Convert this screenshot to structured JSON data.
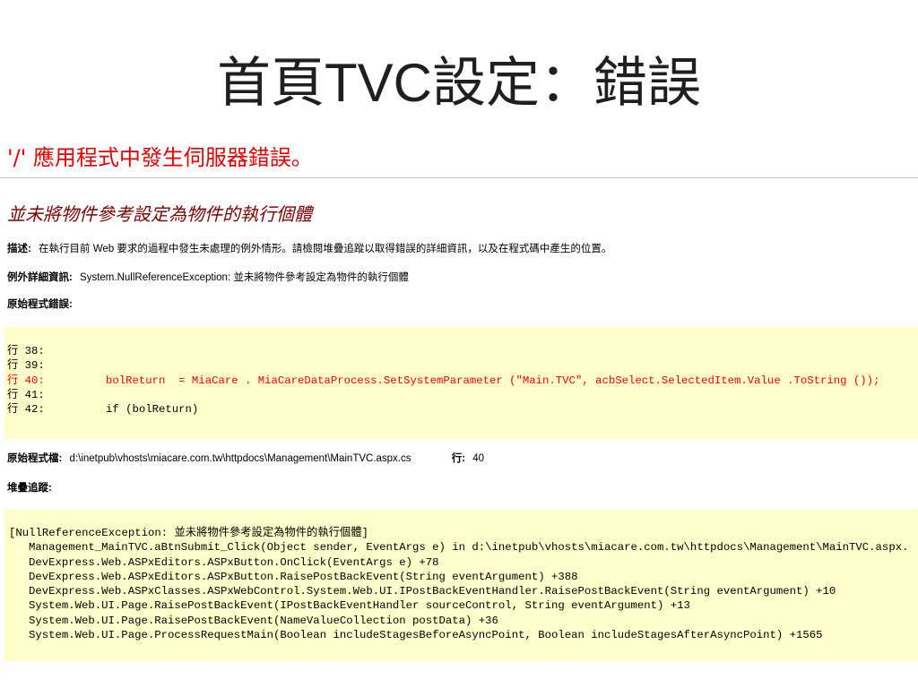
{
  "slide": {
    "title": "首頁TVC設定：錯誤"
  },
  "colors": {
    "title_text": "#1f1f1f",
    "heading": "#e60000",
    "error_message": "#800000",
    "panel_background": "#ffffcc",
    "divider": "#c0c0c0",
    "highlighted_line": "#ff0000"
  },
  "error_page": {
    "heading": "'/' 應用程式中發生伺服器錯誤。",
    "error_message": "並未將物件參考設定為物件的執行個體",
    "description": {
      "label": "描述:",
      "text": "在執行目前 Web 要求的過程中發生未處理的例外情形。請檢閱堆疊追蹤以取得錯誤的詳細資訊，以及在程式碼中產生的位置。"
    },
    "exception_details": {
      "label": "例外詳細資訊:",
      "text": "System.NullReferenceException: 並未將物件參考設定為物件的執行個體"
    },
    "source_error": {
      "label": "原始程式錯誤:",
      "lines": [
        {
          "number": "行 38:",
          "highlighted": false
        },
        {
          "number": "行 39:",
          "highlighted": false
        },
        {
          "number": "行 40:",
          "code": "bolReturn  = MiaCare . MiaCareDataProcess.SetSystemParameter (\"Main.TVC\", acbSelect.SelectedItem.Value .ToString ());",
          "highlighted": true
        },
        {
          "number": "行 41:",
          "highlighted": false
        },
        {
          "number": "行 42:",
          "code": "if (bolReturn)",
          "highlighted": false
        }
      ]
    },
    "source_file": {
      "label": "原始程式檔:",
      "path": "d:\\inetpub\\vhosts\\miacare.com.tw\\httpdocs\\Management\\MainTVC.aspx.cs",
      "line_label": "行:",
      "line_number": "40"
    },
    "stack_trace": {
      "label": "堆疊追蹤:",
      "exception": "[NullReferenceException: 並未將物件參考設定為物件的執行個體]",
      "frames": [
        "Management_MainTVC.aBtnSubmit_Click(Object sender, EventArgs e) in d:\\inetpub\\vhosts\\miacare.com.tw\\httpdocs\\Management\\MainTVC.aspx.",
        "DevExpress.Web.ASPxEditors.ASPxButton.OnClick(EventArgs e) +78",
        "DevExpress.Web.ASPxEditors.ASPxButton.RaisePostBackEvent(String eventArgument) +388",
        "DevExpress.Web.ASPxClasses.ASPxWebControl.System.Web.UI.IPostBackEventHandler.RaisePostBackEvent(String eventArgument) +10",
        "System.Web.UI.Page.RaisePostBackEvent(IPostBackEventHandler sourceControl, String eventArgument) +13",
        "System.Web.UI.Page.RaisePostBackEvent(NameValueCollection postData) +36",
        "System.Web.UI.Page.ProcessRequestMain(Boolean includeStagesBeforeAsyncPoint, Boolean includeStagesAfterAsyncPoint) +1565"
      ]
    }
  }
}
